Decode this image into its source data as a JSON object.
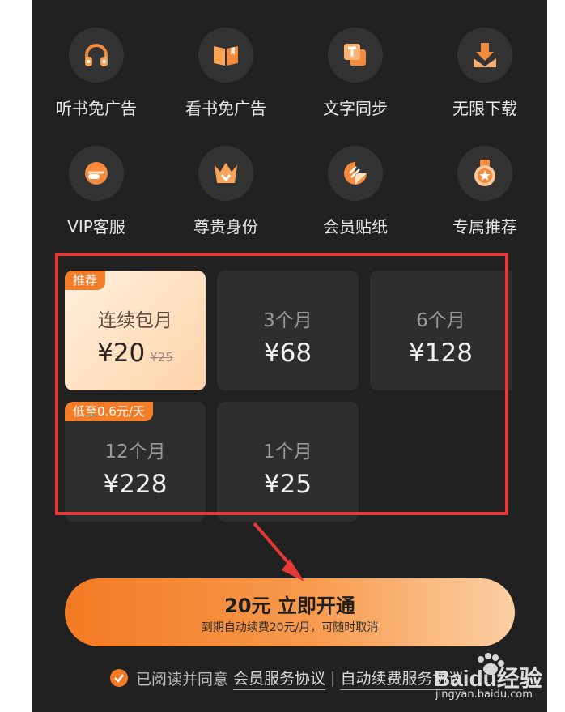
{
  "benefits": [
    {
      "label": "听书免广告",
      "icon": "headphones-icon"
    },
    {
      "label": "看书免广告",
      "icon": "book-icon"
    },
    {
      "label": "文字同步",
      "icon": "text-sync-icon"
    },
    {
      "label": "无限下载",
      "icon": "download-icon"
    },
    {
      "label": "VIP客服",
      "icon": "customer-service-icon"
    },
    {
      "label": "尊贵身份",
      "icon": "crown-icon"
    },
    {
      "label": "会员贴纸",
      "icon": "sticker-icon"
    },
    {
      "label": "专属推荐",
      "icon": "medal-icon"
    }
  ],
  "plans": [
    {
      "badge": "推荐",
      "name": "连续包月",
      "price": "¥20",
      "original_price": "¥25",
      "selected": true
    },
    {
      "name": "3个月",
      "price": "¥68"
    },
    {
      "name": "6个月",
      "price": "¥128"
    },
    {
      "badge": "低至0.6元/天",
      "name": "12个月",
      "price": "¥228"
    },
    {
      "name": "1个月",
      "price": "¥25"
    }
  ],
  "cta": {
    "main": "20元 立即开通",
    "sub": "到期自动续费20元/月，可随时取消"
  },
  "agreement": {
    "prefix": "已阅读并同意",
    "link1": "会员服务协议",
    "separator": "|",
    "link2": "自动续费服务协议"
  },
  "watermark": {
    "text": "Baidu经验",
    "url_text": "jingyan.baidu.com"
  },
  "colors": {
    "accent": "#f27a25",
    "highlight_box": "#e53939",
    "background": "#212121"
  }
}
